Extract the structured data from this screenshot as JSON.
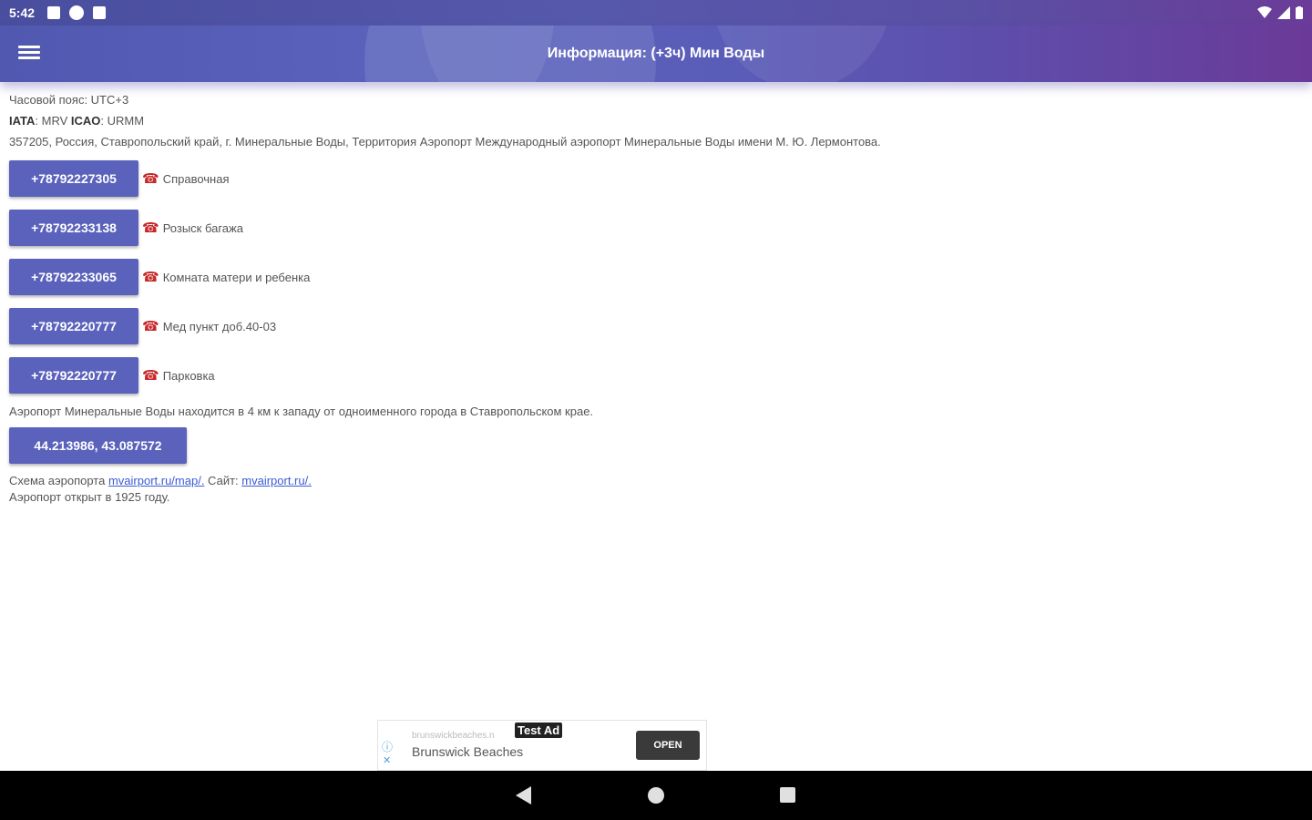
{
  "status_bar": {
    "time": "5:42",
    "icons": [
      "notification-icon",
      "p-icon",
      "sd-card-icon"
    ],
    "right_icons": [
      "wifi-icon",
      "signal-icon",
      "battery-icon"
    ]
  },
  "app_bar": {
    "title": "Информация: (+3ч) Мин Воды",
    "menu_icon": "hamburger-menu-icon"
  },
  "info": {
    "timezone": "Часовой пояс: UTC+3",
    "iata_label": "IATA",
    "iata_value": ": MRV ",
    "icao_label": "ICAO",
    "icao_value": ": URMM",
    "address": "357205, Россия, Ставропольский край, г. Минеральные Воды, Территория Аэропорт Международный аэропорт Минеральные Воды имени М. Ю. Лермонтова."
  },
  "phones": [
    {
      "number": "+78792227305",
      "label": "Справочная"
    },
    {
      "number": "+78792233138",
      "label": "Розыск багажа"
    },
    {
      "number": "+78792233065",
      "label": "Комната матери и ребенка"
    },
    {
      "number": "+78792220777",
      "label": "Мед пункт доб.40-03"
    },
    {
      "number": "+78792220777",
      "label": "Парковка"
    }
  ],
  "phone_icon": "☎",
  "description": "Аэропорт Минеральные Воды находится в 4 км к западу от одноименного города в Ставропольском крае.",
  "coordinates": "44.213986, 43.087572",
  "links": {
    "scheme_prefix": "Схема аэропорта ",
    "scheme_url": "mvairport.ru/map/.",
    "site_prefix": " Сайт: ",
    "site_url": "mvairport.ru/."
  },
  "opened": "Аэропорт открыт в 1925 году.",
  "ad": {
    "domain": "brunswickbeaches.n",
    "title": "Brunswick Beaches",
    "tag": "Test Ad",
    "open_label": "OPEN"
  },
  "nav": {
    "back_icon": "back-triangle-icon",
    "home_icon": "home-circle-icon",
    "recent_icon": "recents-square-icon"
  }
}
